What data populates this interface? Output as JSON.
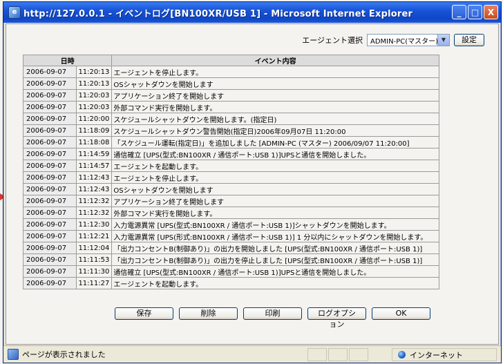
{
  "window": {
    "title": "http://127.0.0.1 - イベントログ[BN100XR/USB 1] - Microsoft Internet Explorer",
    "buttons": {
      "minimize": "_",
      "maximize": "□",
      "close": "X"
    }
  },
  "toolbar": {
    "agent_label": "エージェント選択",
    "agent_value": "ADMIN-PC(マスター)",
    "settings_button": "設定"
  },
  "table": {
    "headers": {
      "datetime": "日時",
      "event": "イベント内容"
    },
    "rows": [
      {
        "date": "2006-09-07",
        "time": "11:20:13",
        "event": "エージェントを停止します。"
      },
      {
        "date": "2006-09-07",
        "time": "11:20:13",
        "event": "OSシャットダウンを開始します"
      },
      {
        "date": "2006-09-07",
        "time": "11:20:03",
        "event": "アプリケーション終了を開始します"
      },
      {
        "date": "2006-09-07",
        "time": "11:20:03",
        "event": "外部コマンド実行を開始します。"
      },
      {
        "date": "2006-09-07",
        "time": "11:20:00",
        "event": "スケジュールシャットダウンを開始します。(指定日)"
      },
      {
        "date": "2006-09-07",
        "time": "11:18:09",
        "event": "スケジュールシャットダウン警告開始(指定日)2006年09月07日 11:20:00"
      },
      {
        "date": "2006-09-07",
        "time": "11:18:08",
        "event": "「スケジュール運転(指定日)」を追加しました [ADMIN-PC (マスター) 2006/09/07 11:20:00]"
      },
      {
        "date": "2006-09-07",
        "time": "11:14:59",
        "event": "通信確立 [UPS(型式:BN100XR / 通信ポート:USB 1)]UPSと通信を開始しました。"
      },
      {
        "date": "2006-09-07",
        "time": "11:14:57",
        "event": "エージェントを起動します。"
      },
      {
        "date": "2006-09-07",
        "time": "11:12:43",
        "event": "エージェントを停止します。"
      },
      {
        "date": "2006-09-07",
        "time": "11:12:43",
        "event": "OSシャットダウンを開始します"
      },
      {
        "date": "2006-09-07",
        "time": "11:12:32",
        "event": "アプリケーション終了を開始します"
      },
      {
        "date": "2006-09-07",
        "time": "11:12:32",
        "event": "外部コマンド実行を開始します。"
      },
      {
        "date": "2006-09-07",
        "time": "11:12:30",
        "event": "入力電源異常 [UPS(型式:BN100XR / 通信ポート:USB 1)]シャットダウンを開始します。"
      },
      {
        "date": "2006-09-07",
        "time": "11:12:21",
        "event": "入力電源異常 [UPS(形式:BN100XR / 通信ポート:USB 1)] 1 分以内にシャットダウンを開始します。"
      },
      {
        "date": "2006-09-07",
        "time": "11:12:04",
        "event": "「出力コンセントB(制御あり)」の出力を開始しました [UPS(型式:BN100XR / 通信ポート:USB 1)]"
      },
      {
        "date": "2006-09-07",
        "time": "11:11:53",
        "event": "「出力コンセントB(制御あり)」の出力を停止しました [UPS(型式:BN100XR / 通信ポート:USB 1)]"
      },
      {
        "date": "2006-09-07",
        "time": "11:11:30",
        "event": "通信確立 [UPS(型式:BN100XR / 通信ポート:USB 1)]UPSと通信を開始しました。"
      },
      {
        "date": "2006-09-07",
        "time": "11:11:27",
        "event": "エージェントを起動します。"
      }
    ]
  },
  "actions": {
    "save": "保存",
    "delete": "削除",
    "print": "印刷",
    "log_options": "ログオプション",
    "ok": "OK"
  },
  "statusbar": {
    "message": "ページが表示されました",
    "zone": "インターネット"
  },
  "colors": {
    "titlebar": "#1854d8",
    "window_bg": "#ece9d8",
    "table_header": "#dcdcdc"
  }
}
